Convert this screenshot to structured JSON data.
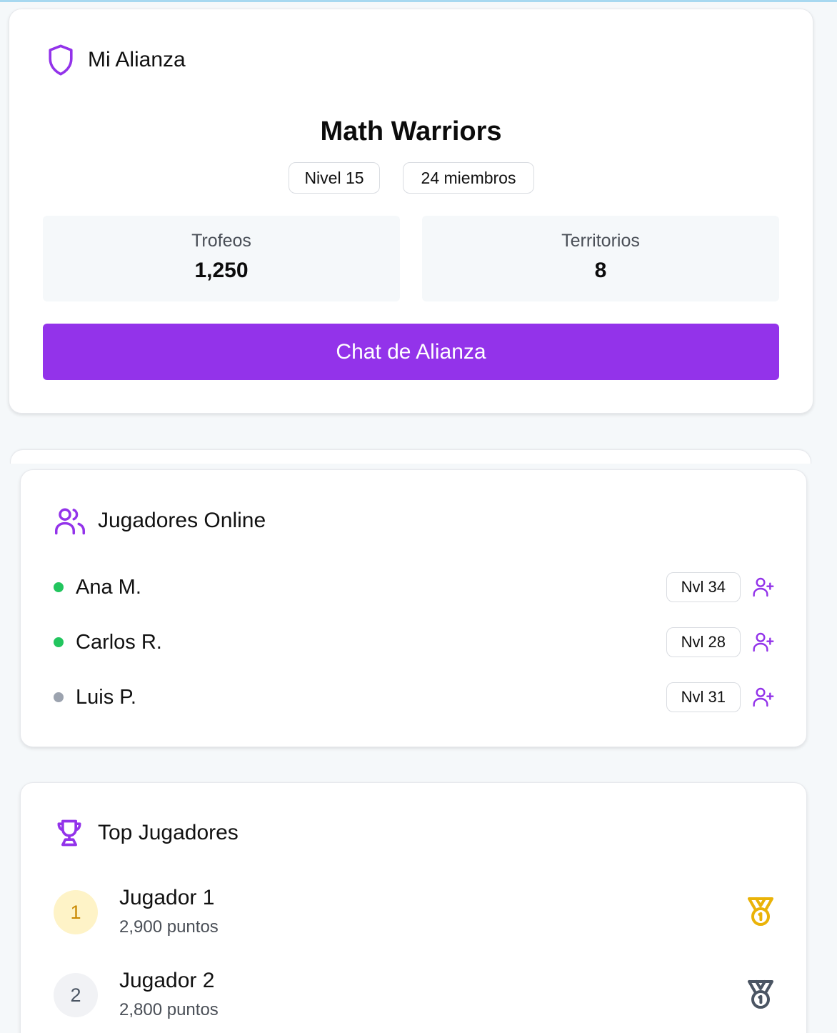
{
  "alliance": {
    "header_title": "Mi Alianza",
    "name": "Math Warriors",
    "level_badge": "Nivel 15",
    "members_badge": "24 miembros",
    "stats": [
      {
        "label": "Trofeos",
        "value": "1,250"
      },
      {
        "label": "Territorios",
        "value": "8"
      }
    ],
    "chat_button_label": "Chat de Alianza"
  },
  "online": {
    "header_title": "Jugadores Online",
    "players": [
      {
        "name": "Ana M.",
        "level": "Nvl 34",
        "status": "online"
      },
      {
        "name": "Carlos R.",
        "level": "Nvl 28",
        "status": "online"
      },
      {
        "name": "Luis P.",
        "level": "Nvl 31",
        "status": "offline"
      }
    ]
  },
  "top": {
    "header_title": "Top Jugadores",
    "players": [
      {
        "rank": "1",
        "name": "Jugador 1",
        "points": "2,900 puntos",
        "medal": "gold-medal-icon"
      },
      {
        "rank": "2",
        "name": "Jugador 2",
        "points": "2,800 puntos",
        "medal": "silver-medal-icon"
      }
    ]
  },
  "colors": {
    "accent": "#9333ea",
    "online": "#22c55e",
    "offline": "#9ca3af",
    "gold": "#eab308",
    "gold_bg": "#fef3c7",
    "silver": "#4b5563",
    "silver_bg": "#f1f2f5"
  }
}
